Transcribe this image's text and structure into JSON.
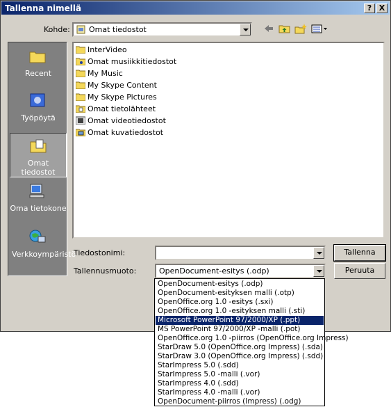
{
  "window": {
    "title": "Tallenna nimellä",
    "help_label": "?",
    "close_label": "X"
  },
  "location": {
    "label": "Kohde:",
    "value": "Omat tiedostot"
  },
  "toolbar": {
    "icons": [
      "back-icon",
      "up-folder-icon",
      "new-folder-icon",
      "views-icon"
    ]
  },
  "places": [
    {
      "label": "Recent",
      "icon": "recent-folder-icon"
    },
    {
      "label": "Työpöytä",
      "icon": "desktop-icon"
    },
    {
      "label": "Omat tiedostot",
      "icon": "my-documents-icon",
      "selected": true
    },
    {
      "label": "Oma tietokone",
      "icon": "computer-icon"
    },
    {
      "label": "Verkkoympäristö",
      "icon": "network-icon"
    }
  ],
  "files": [
    {
      "name": "InterVideo",
      "icon": "folder-icon"
    },
    {
      "name": "Omat musiikkitiedostot",
      "icon": "music-folder-icon"
    },
    {
      "name": "My Music",
      "icon": "folder-icon"
    },
    {
      "name": "My Skype Content",
      "icon": "folder-icon"
    },
    {
      "name": "My Skype Pictures",
      "icon": "folder-icon"
    },
    {
      "name": "Omat tietolähteet",
      "icon": "data-folder-icon"
    },
    {
      "name": "Omat videotiedostot",
      "icon": "video-folder-icon"
    },
    {
      "name": "Omat kuvatiedostot",
      "icon": "pictures-folder-icon"
    }
  ],
  "filename": {
    "label": "Tiedostonimi:",
    "value": ""
  },
  "filetype": {
    "label": "Tallennusmuoto:",
    "value": "OpenDocument-esitys (.odp)"
  },
  "buttons": {
    "save": "Tallenna",
    "cancel": "Peruuta"
  },
  "filetype_options": [
    "OpenDocument-esitys (.odp)",
    "OpenDocument-esityksen malli (.otp)",
    "OpenOffice.org 1.0 -esitys (.sxi)",
    "OpenOffice.org 1.0 -esityksen malli (.sti)",
    "Microsoft PowerPoint 97/2000/XP (.ppt)",
    "MS PowerPoint 97/2000/XP -malli (.pot)",
    "OpenOffice.org 1.0 -piirros (OpenOffice.org Impress)",
    "StarDraw 5.0 (OpenOffice.org Impress) (.sda)",
    "StarDraw 3.0 (OpenOffice.org Impress) (.sdd)",
    "StarImpress 5.0 (.sdd)",
    "StarImpress 5.0 -malli (.vor)",
    "StarImpress 4.0 (.sdd)",
    "StarImpress 4.0 -malli (.vor)",
    "OpenDocument-piirros (Impress) (.odg)"
  ],
  "highlighted_option": "Microsoft PowerPoint 97/2000/XP (.ppt)",
  "colors": {
    "title_start": "#0a246a",
    "title_end": "#a6caf0",
    "face": "#d4d0c8",
    "highlight": "#0a246a"
  }
}
